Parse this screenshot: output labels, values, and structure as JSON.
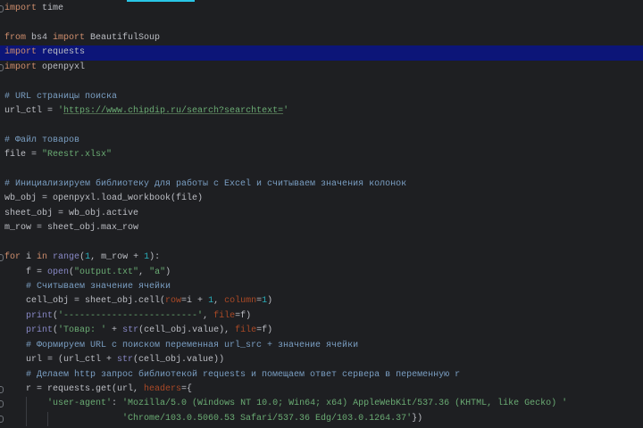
{
  "colors": {
    "background": "#1e1f22",
    "highlight": "#0c1578",
    "keyword": "#cf8e6d",
    "string": "#6aab73",
    "number": "#2aacb8",
    "comment": "#7a9ec2",
    "builtin": "#8888c6",
    "kwarg": "#aa4926"
  },
  "highlighted_line": 3,
  "lines": [
    [
      [
        "kw",
        "import"
      ],
      [
        "id",
        " time"
      ]
    ],
    [],
    [
      [
        "kw",
        "from"
      ],
      [
        "id",
        " bs4 "
      ],
      [
        "kw",
        "import"
      ],
      [
        "id",
        " BeautifulSoup"
      ]
    ],
    [
      [
        "kw",
        "import"
      ],
      [
        "id",
        " requests"
      ]
    ],
    [
      [
        "kw",
        "import"
      ],
      [
        "id",
        " openpyxl"
      ]
    ],
    [],
    [
      [
        "com",
        "# URL страницы поиска"
      ]
    ],
    [
      [
        "id",
        "url_ctl = "
      ],
      [
        "str",
        "'"
      ],
      [
        "url",
        "https://www.chipdip.ru/search?searchtext="
      ],
      [
        "str",
        "'"
      ]
    ],
    [],
    [
      [
        "com",
        "# Файл товаров"
      ]
    ],
    [
      [
        "id",
        "file = "
      ],
      [
        "str",
        "\"Reestr.xlsx\""
      ]
    ],
    [],
    [
      [
        "com",
        "# Инициализируем библиотеку для работы с Excel и считываем значения колонок"
      ]
    ],
    [
      [
        "id",
        "wb_obj = openpyxl.load_workbook(file)"
      ]
    ],
    [
      [
        "id",
        "sheet_obj = wb_obj.active"
      ]
    ],
    [
      [
        "id",
        "m_row = sheet_obj.max_row"
      ]
    ],
    [],
    [
      [
        "kw",
        "for"
      ],
      [
        "id",
        " i "
      ],
      [
        "kw",
        "in"
      ],
      [
        "bi",
        " range"
      ],
      [
        "id",
        "("
      ],
      [
        "num",
        "1"
      ],
      [
        "id",
        ", m_row + "
      ],
      [
        "num",
        "1"
      ],
      [
        "id",
        "):"
      ]
    ],
    [
      [
        "id",
        "    f = "
      ],
      [
        "bi",
        "open"
      ],
      [
        "id",
        "("
      ],
      [
        "str",
        "\"output.txt\""
      ],
      [
        "id",
        ", "
      ],
      [
        "str",
        "\"a\""
      ],
      [
        "id",
        ")"
      ]
    ],
    [
      [
        "com",
        "    # Считываем значение ячейки"
      ]
    ],
    [
      [
        "id",
        "    cell_obj = sheet_obj.cell("
      ],
      [
        "kwarg",
        "row"
      ],
      [
        "id",
        "=i + "
      ],
      [
        "num",
        "1"
      ],
      [
        "id",
        ", "
      ],
      [
        "kwarg",
        "column"
      ],
      [
        "id",
        "="
      ],
      [
        "num",
        "1"
      ],
      [
        "id",
        ")"
      ]
    ],
    [
      [
        "bi",
        "    print"
      ],
      [
        "id",
        "("
      ],
      [
        "str",
        "'-------------------------'"
      ],
      [
        "id",
        ", "
      ],
      [
        "kwarg",
        "file"
      ],
      [
        "id",
        "=f)"
      ]
    ],
    [
      [
        "bi",
        "    print"
      ],
      [
        "id",
        "("
      ],
      [
        "str",
        "'Товар: '"
      ],
      [
        "id",
        " + "
      ],
      [
        "bi",
        "str"
      ],
      [
        "id",
        "(cell_obj.value), "
      ],
      [
        "kwarg",
        "file"
      ],
      [
        "id",
        "=f)"
      ]
    ],
    [
      [
        "com",
        "    # Формируем URL с поиском переменная url_src + значение ячейки"
      ]
    ],
    [
      [
        "id",
        "    url = (url_ctl + "
      ],
      [
        "bi",
        "str"
      ],
      [
        "id",
        "(cell_obj.value))"
      ]
    ],
    [
      [
        "com",
        "    # Делаем http запрос библиотекой requests и помещаем ответ сервера в переменную r"
      ]
    ],
    [
      [
        "id",
        "    r = requests.get(url, "
      ],
      [
        "kwarg",
        "headers"
      ],
      [
        "id",
        "={"
      ]
    ],
    [
      [
        "str",
        "        'user-agent'"
      ],
      [
        "id",
        ": "
      ],
      [
        "str",
        "'Mozilla/5.0 (Windows NT 10.0; Win64; x64) AppleWebKit/537.36 (KHTML, like Gecko) '"
      ]
    ],
    [
      [
        "str",
        "                      'Chrome/103.0.5060.53 Safari/537.36 Edg/103.0.1264.37'"
      ],
      [
        "id",
        "})"
      ]
    ]
  ]
}
